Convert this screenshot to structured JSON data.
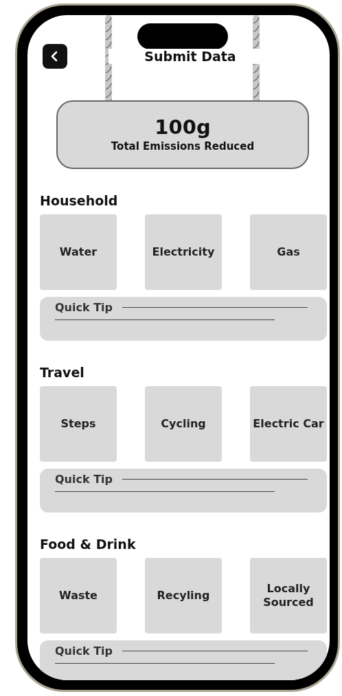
{
  "header": {
    "title": "Submit Data"
  },
  "summary": {
    "value": "100g",
    "label": "Total Emissions Reduced"
  },
  "sections": [
    {
      "title": "Household",
      "tiles": [
        "Water",
        "Electricity",
        "Gas"
      ],
      "tip": "Quick Tip"
    },
    {
      "title": "Travel",
      "tiles": [
        "Steps",
        "Cycling",
        "Electric Car"
      ],
      "tip": "Quick Tip"
    },
    {
      "title": "Food & Drink",
      "tiles": [
        "Waste",
        "Recyling",
        "Locally Sourced"
      ],
      "tip": "Quick Tip"
    }
  ]
}
